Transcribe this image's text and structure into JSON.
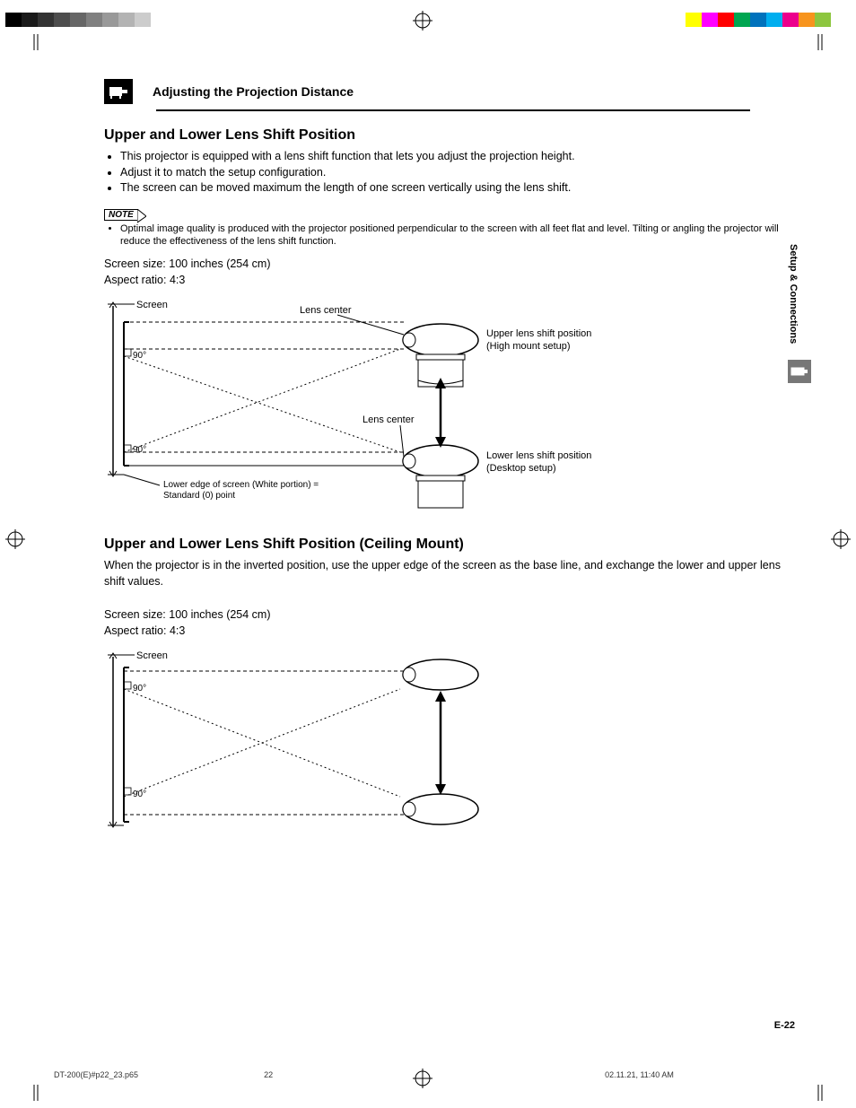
{
  "header": {
    "title": "Adjusting the Projection Distance"
  },
  "section1": {
    "heading": "Upper and Lower Lens Shift Position",
    "bullets": [
      "This projector is equipped with a lens shift function that lets you adjust the projection height.",
      "Adjust it to match the setup configuration.",
      "The screen can be moved maximum the length of one screen vertically using the lens shift."
    ],
    "note_label": "NOTE",
    "note_bullets": [
      "Optimal image quality is produced with the projector positioned perpendicular to the screen with all feet flat and level. Tilting or angling the projector will reduce the effectiveness of the lens shift function."
    ],
    "spec_line1": "Screen size:  100 inches (254 cm)",
    "spec_line2": "Aspect ratio:  4:3",
    "diagram": {
      "screen_label": "Screen",
      "lens_center_upper": "Lens center",
      "lens_center_lower": "Lens center",
      "upper_text1": "Upper lens shift position",
      "upper_text2": "(High mount setup)",
      "lower_text1": "Lower lens shift position",
      "lower_text2": "(Desktop setup)",
      "angle": "90°",
      "edge_note1": "Lower edge of screen (White portion) =",
      "edge_note2": "Standard (0) point"
    }
  },
  "section2": {
    "heading": "Upper and Lower Lens Shift Position (Ceiling Mount)",
    "intro": "When the projector is in the inverted position, use the upper edge of the screen as the base line, and exchange the lower and upper lens shift values.",
    "spec_line1": "Screen size:  100 inches (254 cm)",
    "spec_line2": "Aspect ratio:  4:3",
    "diagram": {
      "screen_label": "Screen",
      "angle": "90°"
    }
  },
  "side_tab": "Setup & Connections",
  "page_number": "E-22",
  "footer": {
    "file": "DT-200(E)#p22_23.p65",
    "page": "22",
    "date": "02.11.21, 11:40 AM"
  },
  "colorbar": [
    "#000",
    "#1a1a1a",
    "#333",
    "#4d4d4d",
    "#666",
    "#808080",
    "#999",
    "#b3b3b3",
    "#ccc",
    "#fff",
    "#fff",
    "#fff",
    "#ffff00",
    "#ff00ff",
    "#ff0000",
    "#00a651",
    "#0072bc",
    "#00aeef",
    "#ec008c",
    "#f7941d",
    "#8dc63f"
  ]
}
